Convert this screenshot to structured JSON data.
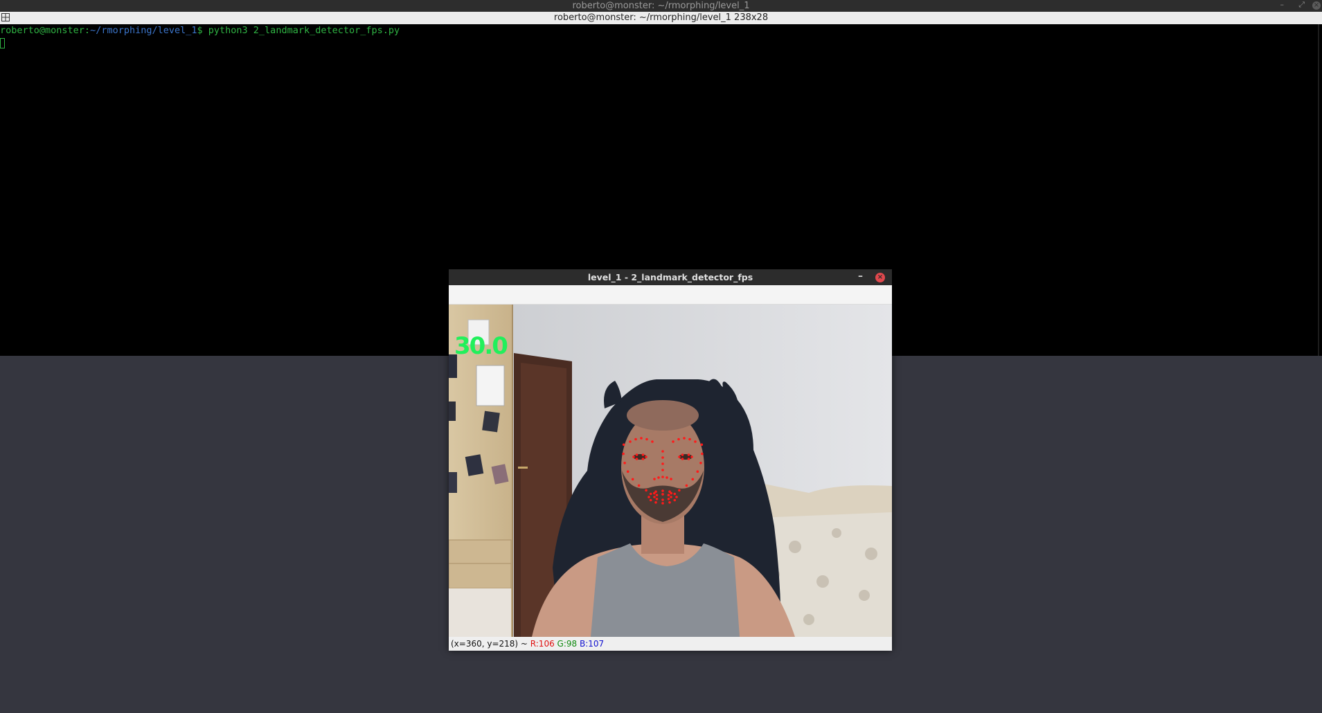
{
  "terminal": {
    "window_title": "roberto@monster: ~/rmorphing/level_1",
    "tab_title": "roberto@monster: ~/rmorphing/level_1 238x28",
    "prompt_user": "roberto@monster",
    "prompt_sep": ":",
    "prompt_path": "~/rmorphing/level_1",
    "prompt_symbol": "$",
    "command": "python3 2_landmark_detector_fps.py",
    "controls": {
      "minimize": "–",
      "maximize": "⤢",
      "close": "×"
    }
  },
  "cv_window": {
    "title": "level_1 - 2_landmark_detector_fps",
    "minimize_glyph": "–",
    "close_glyph": "×",
    "fps_overlay": "30.0",
    "status": {
      "coords": "(x=360, y=218) ~ ",
      "r": "R:106",
      "g": "G:98",
      "b": "B:107"
    }
  },
  "colors": {
    "desktop": "#35363f",
    "terminal_bg": "#000000",
    "prompt_green": "#2fb343",
    "prompt_blue": "#3b74c9",
    "fps_green": "#21f05b",
    "landmark_red": "#ff1a1a",
    "close_red": "#e0484d"
  }
}
